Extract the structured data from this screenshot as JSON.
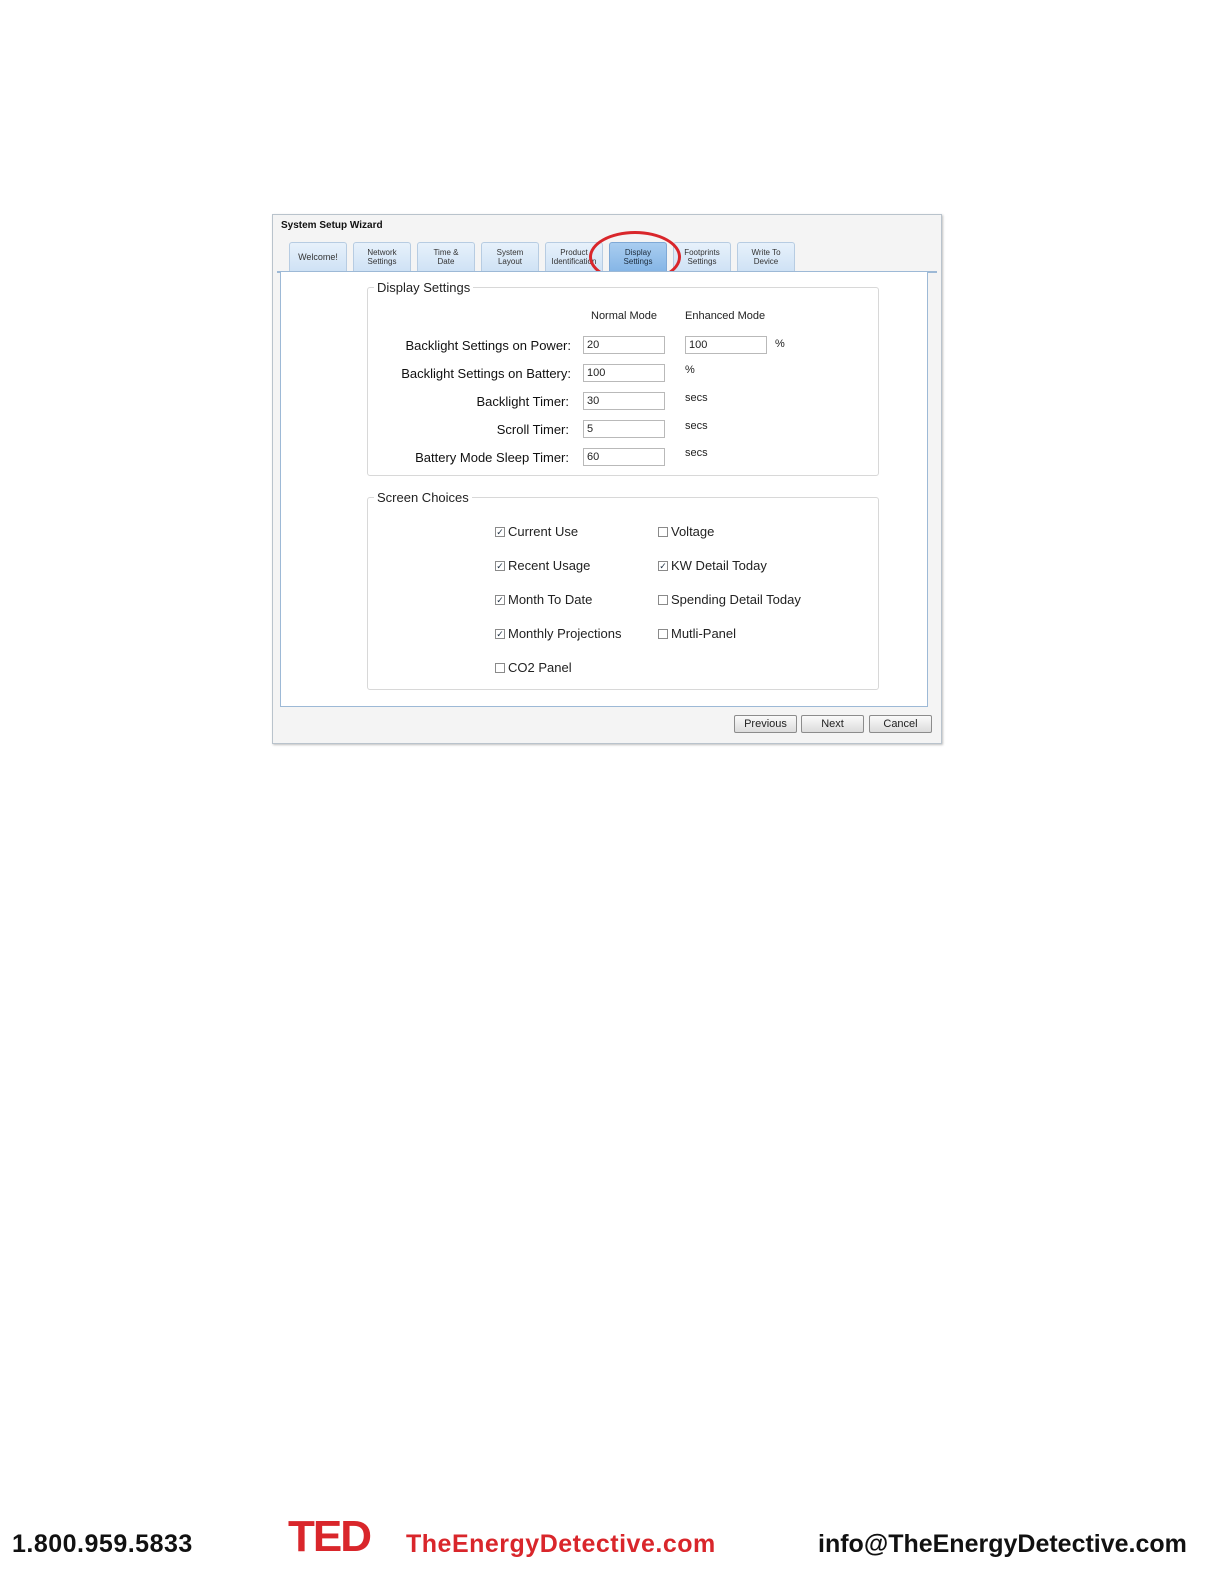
{
  "window": {
    "title": "System Setup Wizard"
  },
  "tabs": [
    {
      "label": "Welcome!"
    },
    {
      "label": "Network\nSettings"
    },
    {
      "label": "Time &\nDate"
    },
    {
      "label": "System\nLayout"
    },
    {
      "label": "Product\nIdentification"
    },
    {
      "label": "Display\nSettings",
      "active": true
    },
    {
      "label": "Footprints\nSettings"
    },
    {
      "label": "Write To\nDevice"
    }
  ],
  "display_settings": {
    "legend": "Display Settings",
    "col_normal": "Normal Mode",
    "col_enhanced": "Enhanced Mode",
    "rows": [
      {
        "label": "Backlight Settings on Power:",
        "normal": "20",
        "enhanced": "100",
        "unit": "%"
      },
      {
        "label": "Backlight Settings on Battery:",
        "normal": "100",
        "unit": "%"
      },
      {
        "label": "Backlight Timer:",
        "normal": "30",
        "unit": "secs"
      },
      {
        "label": "Scroll Timer:",
        "normal": "5",
        "unit": "secs"
      },
      {
        "label": "Battery Mode Sleep Timer:",
        "normal": "60",
        "unit": "secs"
      }
    ]
  },
  "screen_choices": {
    "legend": "Screen Choices",
    "items": [
      {
        "label": "Current Use",
        "checked": true
      },
      {
        "label": "Voltage",
        "checked": false
      },
      {
        "label": "Recent Usage",
        "checked": true
      },
      {
        "label": "KW Detail Today",
        "checked": true
      },
      {
        "label": "Month To Date",
        "checked": true
      },
      {
        "label": "Spending Detail Today",
        "checked": false
      },
      {
        "label": "Monthly Projections",
        "checked": true
      },
      {
        "label": "Mutli-Panel",
        "checked": false
      },
      {
        "label": "CO2 Panel",
        "checked": false
      }
    ]
  },
  "buttons": {
    "previous": "Previous",
    "next": "Next",
    "cancel": "Cancel"
  },
  "footer": {
    "phone": "1.800.959.5833",
    "logo_text": "TED",
    "site": "TheEnergyDetective.com",
    "email": "info@TheEnergyDetective.com"
  },
  "colors": {
    "accent_red": "#d9262b",
    "tab_active": "#86b6e6",
    "tab_idle": "#cfe2f5"
  }
}
